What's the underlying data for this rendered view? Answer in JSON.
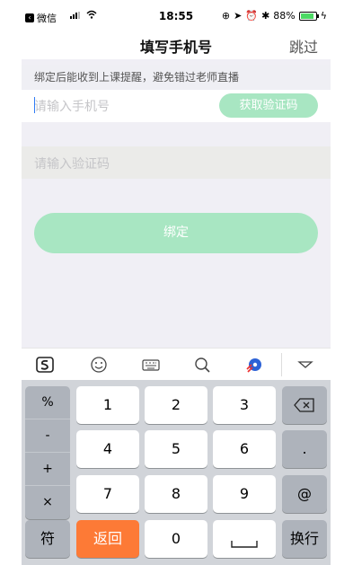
{
  "status_bar": {
    "back_app": "微信",
    "time": "18:55",
    "battery": "88%"
  },
  "nav": {
    "title": "填写手机号",
    "skip_label": "跳过"
  },
  "form": {
    "hint": "绑定后能收到上课提醒，避免错过老师直播",
    "phone_placeholder": "请输入手机号",
    "get_code_label": "获取验证码",
    "code_placeholder": "请输入验证码",
    "bind_label": "绑定"
  },
  "keyboard": {
    "toolbar_icons": [
      "sogou-logo-icon",
      "emoji-icon",
      "keyboard-icon",
      "search-icon",
      "game-icon",
      "collapse-icon"
    ],
    "symbols": [
      "%",
      "-",
      "+",
      "×"
    ],
    "digits": [
      "1",
      "2",
      "3",
      "4",
      "5",
      "6",
      "7",
      "8",
      "9",
      "0"
    ],
    "dot": ".",
    "at": "@",
    "fu_label": "符",
    "back_label": "返回",
    "enter_label": "换行"
  },
  "colors": {
    "accent_green": "#a8e6c2",
    "return_orange": "#fd7a36",
    "battery_green": "#4cd964"
  }
}
